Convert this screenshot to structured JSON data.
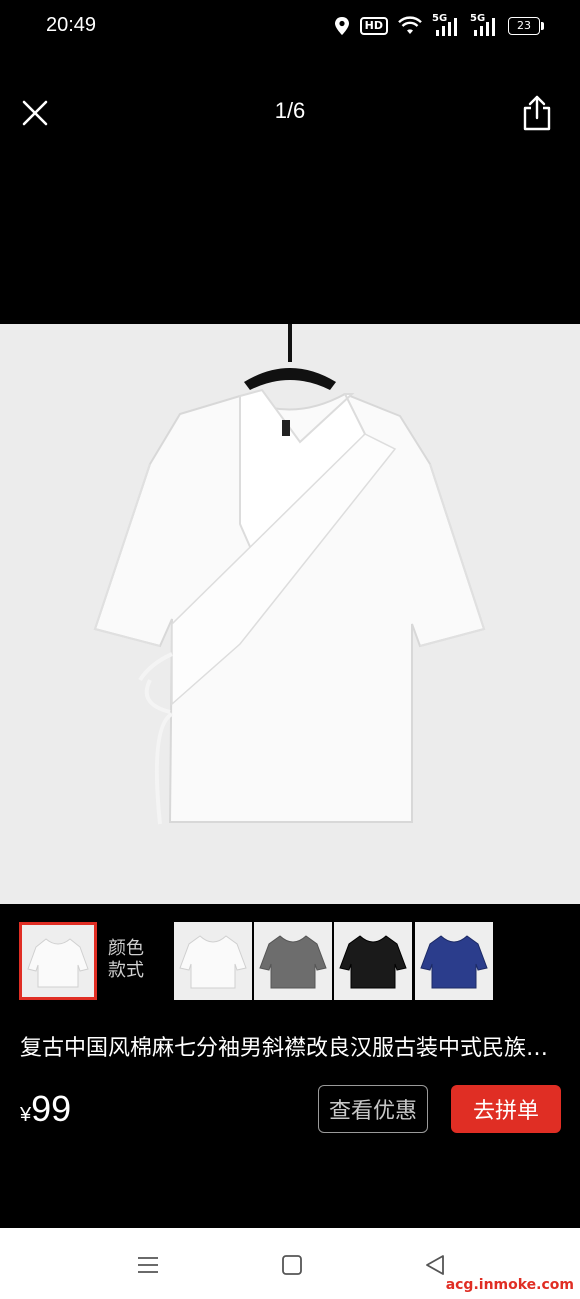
{
  "status_bar": {
    "time": "20:49",
    "hd_label": "HD",
    "net1": "5G",
    "net2": "5G",
    "battery": "23",
    "icons": [
      "location-icon",
      "hd-icon",
      "wifi-icon",
      "signal-icon",
      "signal-icon",
      "battery-icon"
    ]
  },
  "viewer": {
    "page_counter": "1/6",
    "close_icon": "close-icon",
    "share_icon": "share-icon"
  },
  "style_selector": {
    "label_line1": "颜色",
    "label_line2": "款式",
    "thumbnails": [
      {
        "color": "white",
        "selected": true
      },
      {
        "color": "white",
        "selected": false
      },
      {
        "color": "gray",
        "selected": false
      },
      {
        "color": "black",
        "selected": false
      },
      {
        "color": "navy",
        "selected": false
      }
    ]
  },
  "product": {
    "title": "复古中国风棉麻七分袖男斜襟改良汉服古装中式民族风唐装",
    "currency": "¥",
    "price": "99"
  },
  "actions": {
    "coupon_label": "查看优惠",
    "group_buy_label": "去拼单"
  },
  "nav": {
    "menu_icon": "menu-icon",
    "home_icon": "home-icon",
    "back_icon": "back-icon"
  },
  "watermark": "acg.inmoke.com",
  "colors": {
    "accent": "#e02e24",
    "background": "#000000",
    "image_bg": "#ececec",
    "navbar_bg": "#ffffff"
  }
}
